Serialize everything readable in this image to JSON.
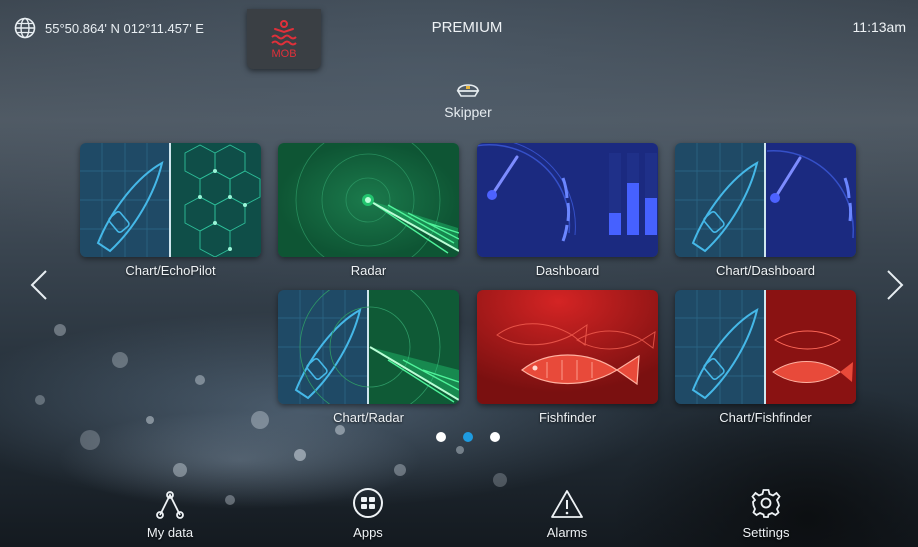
{
  "status_bar": {
    "coordinates": "55°50.864' N  012°11.457' E",
    "title": "PREMIUM",
    "time": "11:13am",
    "mob_label": "MOB"
  },
  "profile": {
    "name": "Skipper",
    "icon": "captain-hat-icon"
  },
  "tiles": [
    {
      "label": "Chart/EchoPilot",
      "icon": "chart-echopilot-thumbnail"
    },
    {
      "label": "Radar",
      "icon": "radar-thumbnail"
    },
    {
      "label": "Dashboard",
      "icon": "dashboard-thumbnail"
    },
    {
      "label": "Chart/Dashboard",
      "icon": "chart-dashboard-thumbnail"
    },
    {
      "label": "Chart/Radar",
      "icon": "chart-radar-thumbnail"
    },
    {
      "label": "Fishfinder",
      "icon": "fishfinder-thumbnail"
    },
    {
      "label": "Chart/Fishfinder",
      "icon": "chart-fishfinder-thumbnail"
    }
  ],
  "pagination": {
    "pages": 3,
    "active_index": 1
  },
  "bottom_bar": [
    {
      "label": "My data",
      "icon": "my-data-icon"
    },
    {
      "label": "Apps",
      "icon": "apps-icon"
    },
    {
      "label": "Alarms",
      "icon": "alarm-warning-icon"
    },
    {
      "label": "Settings",
      "icon": "gear-icon"
    }
  ],
  "colors": {
    "accent": "#1e9be0",
    "mob_red": "#e0303a",
    "chart_bg": "#1f4a66",
    "radar_bg": "#0f5a36",
    "dashboard_bg": "#1b2a80",
    "fishfinder_bg": "#8a1212"
  }
}
